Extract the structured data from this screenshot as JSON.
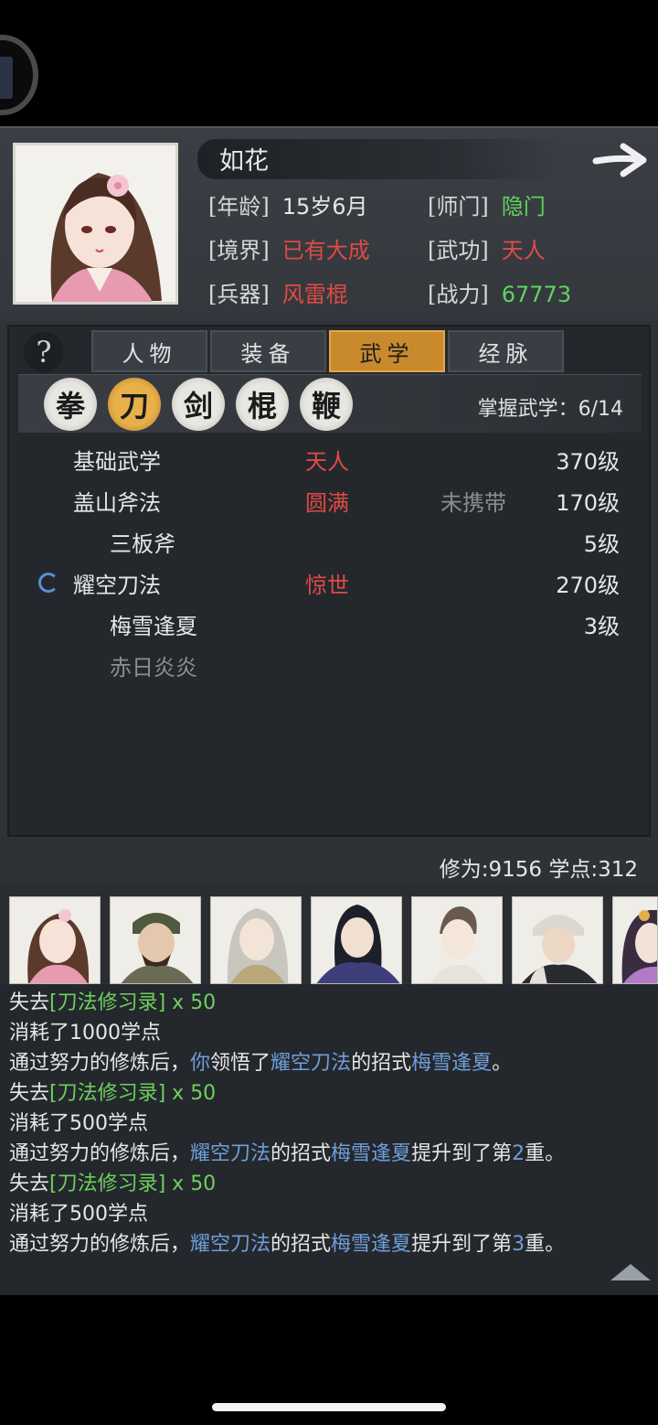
{
  "header": {
    "name": "如花",
    "age_key": "[年龄]",
    "age": "15岁6月",
    "sect_key": "[师门]",
    "sect": "隐门",
    "realm_key": "[境界]",
    "realm": "已有大成",
    "martial_key": "[武功]",
    "martial": "天人",
    "weapon_key": "[兵器]",
    "weapon": "风雷棍",
    "power_key": "[战力]",
    "power": "67773"
  },
  "tabs": [
    "人物",
    "装备",
    "武学",
    "经脉"
  ],
  "active_tab": "武学",
  "weapon_types": [
    "拳",
    "刀",
    "剑",
    "棍",
    "鞭"
  ],
  "active_weapon_type": "刀",
  "mastery": "掌握武学：6/14",
  "skills": [
    {
      "name": "基础武学",
      "rank": "天人",
      "carry": "",
      "level": "370级"
    },
    {
      "name": "盖山斧法",
      "rank": "圆满",
      "carry": "未携带",
      "level": "170级"
    },
    {
      "name": "三板斧",
      "rank": "",
      "carry": "",
      "level": "5级"
    },
    {
      "name": "耀空刀法",
      "rank": "惊世",
      "carry": "",
      "level": "270级"
    },
    {
      "name": "梅雪逢夏",
      "rank": "",
      "carry": "",
      "level": "3级"
    },
    {
      "name": "赤日炎炎",
      "rank": "",
      "carry": "",
      "level": ""
    }
  ],
  "stats": "修为:9156  学点:312",
  "log": {
    "lost_prefix": "失去",
    "lost_item": "[刀法修习录] x 50",
    "consume_1000": "消耗了1000学点",
    "consume_500": "消耗了500学点",
    "train_prefix": "通过努力的修炼后，",
    "you": "你",
    "learned": "领悟了",
    "skill": "耀空刀法",
    "de_zhaoshi": "的招式",
    "move": "梅雪逢夏",
    "period": "。",
    "raised": "提升到了第",
    "level2": "2",
    "level3": "3",
    "layer": "重。"
  },
  "colors": {
    "red": "#e04a44",
    "green": "#5fd35f",
    "blue": "#6f9ed8",
    "orange": "#c98a2e"
  }
}
